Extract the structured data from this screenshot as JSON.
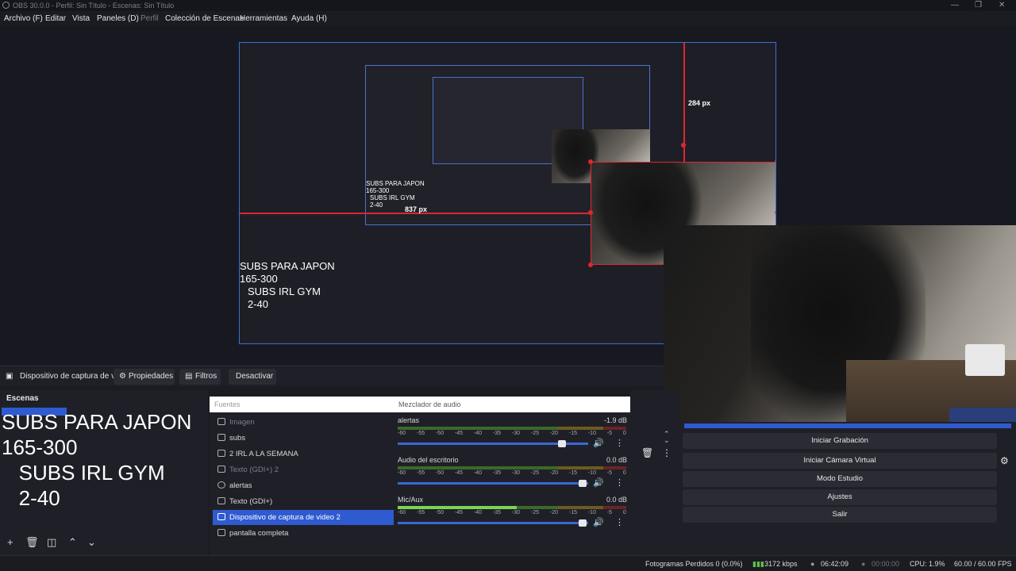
{
  "window": {
    "title": "OBS 30.0.0 - Perfil: Sin Título - Escenas: Sin Título",
    "controls": [
      "—",
      "❐",
      "✕"
    ]
  },
  "menu": [
    {
      "label": "Archivo (F)",
      "dim": false
    },
    {
      "label": "Editar",
      "dim": false
    },
    {
      "label": "Vista",
      "dim": false
    },
    {
      "label": "Paneles (D)",
      "dim": false
    },
    {
      "label": "Perfil",
      "dim": true
    },
    {
      "label": "Colección de Escenas",
      "dim": false
    },
    {
      "label": "Herramientas",
      "dim": false
    },
    {
      "label": "Ayuda (H)",
      "dim": false
    }
  ],
  "preview": {
    "distance_top": "284 px",
    "distance_left": "837 px",
    "inner_overlay": {
      "line1": "SUBS PARA JAPON",
      "line2": "165-300",
      "line3": "SUBS IRL GYM",
      "line4": "2-40"
    }
  },
  "source_toolbar": {
    "selected_source": "Dispositivo de captura de v",
    "properties": "Propiedades",
    "filters": "Filtros",
    "deactivate": "Desactivar"
  },
  "scenes": {
    "title": "Escenas",
    "overlay_text": "SUBS PARA JAPON\n165-300\n   SUBS IRL GYM\n   2-40"
  },
  "sources": {
    "placeholder": "Fuentes",
    "items": [
      {
        "label": "Imagen",
        "icon": "image-icon",
        "dim": true
      },
      {
        "label": "subs",
        "icon": "media-icon",
        "dim": false
      },
      {
        "label": "2 IRL A LA SEMANA",
        "icon": "media-icon",
        "dim": false
      },
      {
        "label": "Texto (GDI+) 2",
        "icon": "text-icon",
        "dim": true
      },
      {
        "label": "alertas",
        "icon": "browser-icon",
        "dim": false
      },
      {
        "label": "Texto (GDI+)",
        "icon": "text-icon",
        "dim": false
      },
      {
        "label": "Dispositivo de captura de video 2",
        "icon": "camera-icon",
        "dim": false,
        "selected": true
      },
      {
        "label": "pantalla completa",
        "icon": "monitor-icon",
        "dim": false
      }
    ]
  },
  "mixer": {
    "title": "Mezclador de audio",
    "ticks": [
      "-60",
      "-55",
      "-50",
      "-45",
      "-40",
      "-35",
      "-30",
      "-25",
      "-20",
      "-15",
      "-10",
      "-5",
      "0"
    ],
    "channels": [
      {
        "name": "alertas",
        "db": "-1.9 dB",
        "level": 0,
        "fader": 0.88
      },
      {
        "name": "Audio del escritorio",
        "db": "0.0 dB",
        "level": 0,
        "fader": 0.99
      },
      {
        "name": "Mic/Aux",
        "db": "0.0 dB",
        "level": 0.52,
        "fader": 0.99
      }
    ]
  },
  "controls": {
    "start_recording": "Iniciar Grabación",
    "start_virtual_cam": "Iniciar Cámara Virtual",
    "studio_mode": "Modo Estudio",
    "settings": "Ajustes",
    "exit": "Salir"
  },
  "status": {
    "dropped_frames": "Fotogramas Perdidos 0 (0.0%)",
    "bitrate": "3172 kbps",
    "stream_time": "06:42:09",
    "rec_time": "00:00:00",
    "cpu": "CPU: 1.9%",
    "fps": "60.00 / 60.00 FPS"
  },
  "colors": {
    "accent": "#2f5bd0",
    "guide": "#e0262f",
    "bg": "#1b1c22",
    "panel": "#1f2027"
  }
}
